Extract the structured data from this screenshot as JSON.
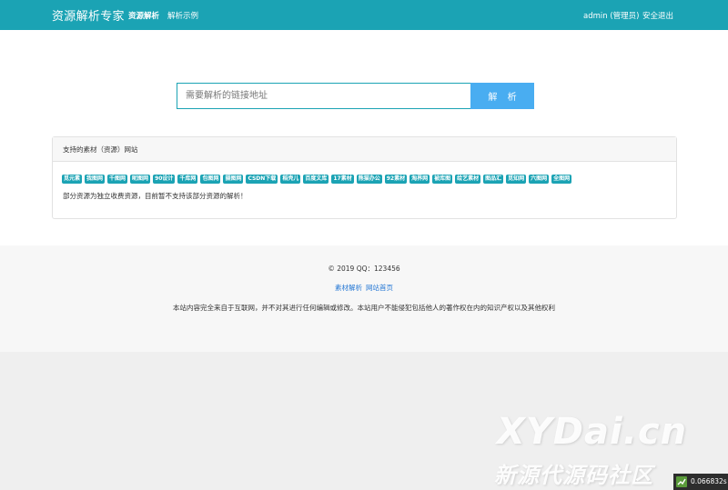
{
  "header": {
    "brand": "资源解析专家",
    "nav": [
      "资源解析",
      "解析示例"
    ],
    "user": "admin (管理员)",
    "logout": "安全退出"
  },
  "search": {
    "placeholder": "需要解析的链接地址",
    "button_label": "解 析"
  },
  "sites_panel": {
    "title": "支持的素材（资源）网站",
    "tags": [
      "觅元素",
      "我图网",
      "千图网",
      "昵图网",
      "90设计",
      "千库网",
      "包图网",
      "摄图网",
      "CSDN下载",
      "稻壳儿",
      "百度文库",
      "17素材",
      "熊猫办公",
      "92素材",
      "淘界网",
      "被库图",
      "绘艺素材",
      "图品汇",
      "觅知网",
      "六图网",
      "全图网"
    ],
    "notice": "部分资源为独立收费资源，目前暂不支持该部分资源的解析！"
  },
  "footer": {
    "copyright": "© 2019 QQ：123456",
    "links": [
      "素材解析",
      "网站首页"
    ],
    "disclaimer": "本站内容完全来自于互联网，并不对其进行任何编辑或修改。本站用户不能侵犯包括他人的著作权在内的知识产权以及其他权利"
  },
  "watermark": {
    "brand": "XYDai.cn",
    "subtitle": "新源代源码社区"
  },
  "timer": "0.066832s",
  "colors": {
    "header_bg": "#1ba3b4",
    "button_bg": "#49adf1",
    "tag_bg": "#1ba3b4",
    "link": "#2477d4"
  }
}
